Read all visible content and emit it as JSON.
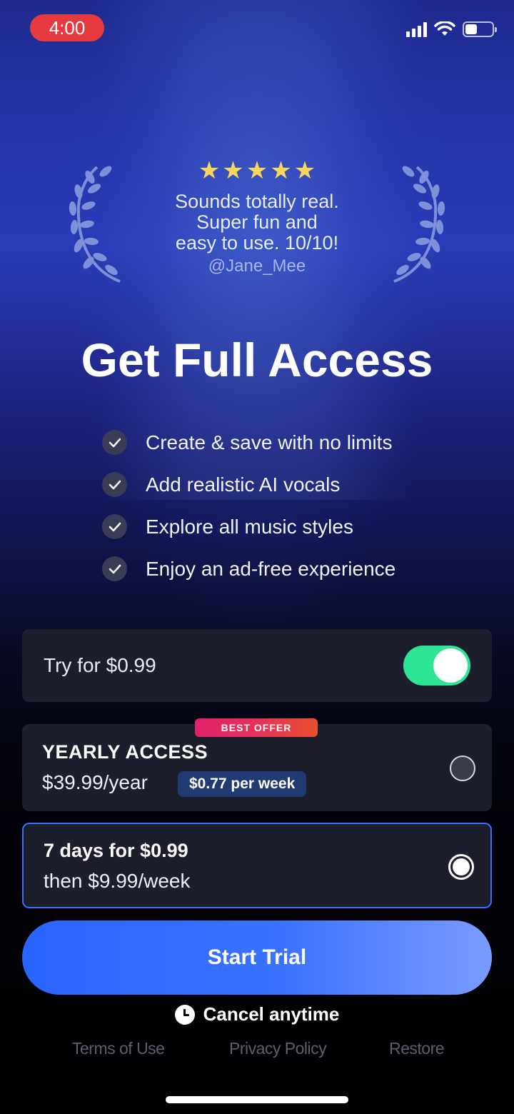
{
  "status_bar": {
    "time": "4:00"
  },
  "review": {
    "rating_stars": 5,
    "text_lines": [
      "Sounds totally real.",
      "Super fun and",
      "easy to use. 10/10!"
    ],
    "handle": "@Jane_Mee"
  },
  "title": "Get Full Access",
  "features": [
    "Create & save with no limits",
    "Add realistic AI vocals",
    "Explore all music styles",
    "Enjoy an ad-free experience"
  ],
  "trial_toggle": {
    "label": "Try for $0.99",
    "on": true
  },
  "plans": {
    "yearly": {
      "badge": "BEST OFFER",
      "title": "YEARLY ACCESS",
      "price": "$39.99/year",
      "per_week": "$0.77 per week",
      "selected": false
    },
    "weekly": {
      "title": "7 days for $0.99",
      "price": "then $9.99/week",
      "selected": true
    }
  },
  "cta_label": "Start Trial",
  "cancel_label": "Cancel anytime",
  "footer_links": [
    "Terms of Use",
    "Privacy Policy",
    "Restore"
  ],
  "colors": {
    "accent": "#3f6fff",
    "toggle_on": "#2ee596",
    "star": "#f7d65a",
    "status_pill": "#e53a3f"
  }
}
